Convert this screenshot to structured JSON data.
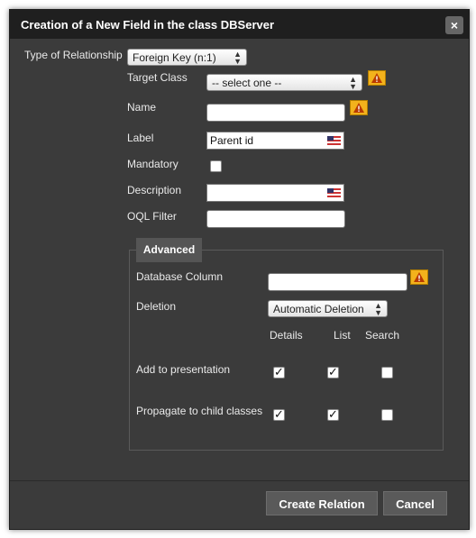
{
  "dialog": {
    "title": "Creation of a New Field in the class DBServer",
    "close_label": "×"
  },
  "form": {
    "type_of_relationship": {
      "label": "Type of Relationship",
      "value": "Foreign Key (n:1)"
    },
    "target_class": {
      "label": "Target Class",
      "value": "-- select one --"
    },
    "name": {
      "label": "Name",
      "value": ""
    },
    "label": {
      "label": "Label",
      "value": "Parent id"
    },
    "mandatory": {
      "label": "Mandatory",
      "checked": false
    },
    "description": {
      "label": "Description",
      "value": ""
    },
    "oql_filter": {
      "label": "OQL Filter",
      "value": ""
    }
  },
  "advanced": {
    "legend": "Advanced",
    "database_column": {
      "label": "Database Column",
      "value": ""
    },
    "deletion": {
      "label": "Deletion",
      "value": "Automatic Deletion"
    },
    "columns": [
      "Details",
      "List",
      "Search"
    ],
    "rows": [
      {
        "label": "Add to presentation",
        "checks": [
          true,
          true,
          false
        ]
      },
      {
        "label": "Propagate to child classes",
        "checks": [
          true,
          true,
          false
        ]
      }
    ]
  },
  "buttons": {
    "create": "Create Relation",
    "cancel": "Cancel"
  },
  "colors": {
    "dialog_bg": "#3b3b3b",
    "titlebar_bg": "#1f1f1f",
    "warning": "#f3b21c"
  },
  "icons": {
    "warning": "warning-icon",
    "flag": "us-flag-icon",
    "close": "close-icon"
  }
}
